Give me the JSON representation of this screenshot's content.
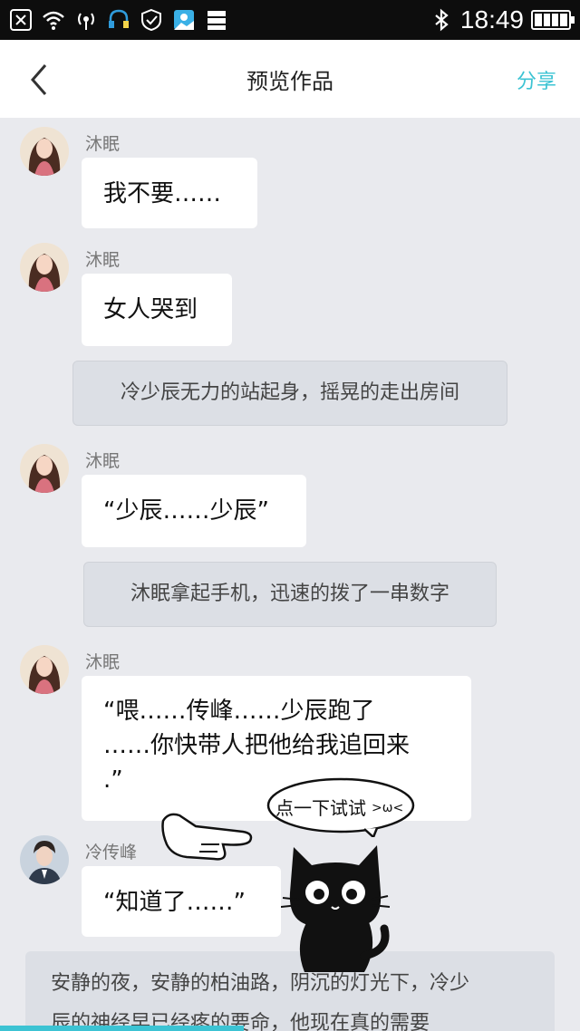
{
  "status_bar": {
    "time": "18:49"
  },
  "navbar": {
    "title": "预览作品",
    "share": "分享"
  },
  "messages": [
    {
      "sender": "沐眠",
      "text": "我不要……"
    },
    {
      "sender": "沐眠",
      "text": "女人哭到"
    },
    {
      "narration": "冷少辰无力的站起身，摇晃的走出房间"
    },
    {
      "sender": "沐眠",
      "text": "“少辰……少辰”"
    },
    {
      "narration": "沐眠拿起手机，迅速的拨了一串数字"
    },
    {
      "sender": "沐眠",
      "lines": [
        "“喂……传峰……少辰跑了",
        "……你快带人把他给我追回来",
        ".”"
      ]
    },
    {
      "sender": "冷传峰",
      "text": "“知道了……”"
    },
    {
      "narration_lines": [
        "安静的夜，安静的柏油路，阴沉的灯光下，冷少",
        "辰的神经早已经疼的要命，他现在真的需要"
      ]
    }
  ],
  "overlay": {
    "tap_hint": "点一下试试"
  },
  "colors": {
    "accent": "#3cc3d3",
    "background": "#e9eaee"
  },
  "progress": 0.42
}
